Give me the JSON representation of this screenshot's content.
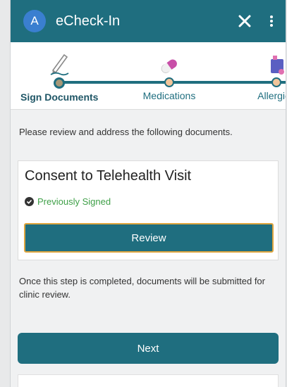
{
  "appbar": {
    "avatar_letter": "A",
    "title": "eCheck-In",
    "close_label": "✕",
    "menu_label": "⋮"
  },
  "stepper": {
    "steps": [
      {
        "label": "Sign Documents",
        "icon": "pen-icon",
        "state": "active"
      },
      {
        "label": "Medications",
        "icon": "pill-icon",
        "state": "pending"
      },
      {
        "label": "Allergies",
        "icon": "allergy-icon",
        "state": "pending"
      }
    ]
  },
  "main": {
    "instructions": "Please review and address the following documents.",
    "document": {
      "title": "Consent to Telehealth Visit",
      "status": "Previously Signed",
      "review_label": "Review"
    },
    "note": "Once this step is completed, documents will be submitted for clinic review.",
    "next_label": "Next"
  },
  "colors": {
    "primary": "#1f6e7f",
    "avatar": "#3a7fd0",
    "signed_green": "#3fa048",
    "focus_outline": "#e0a640"
  }
}
